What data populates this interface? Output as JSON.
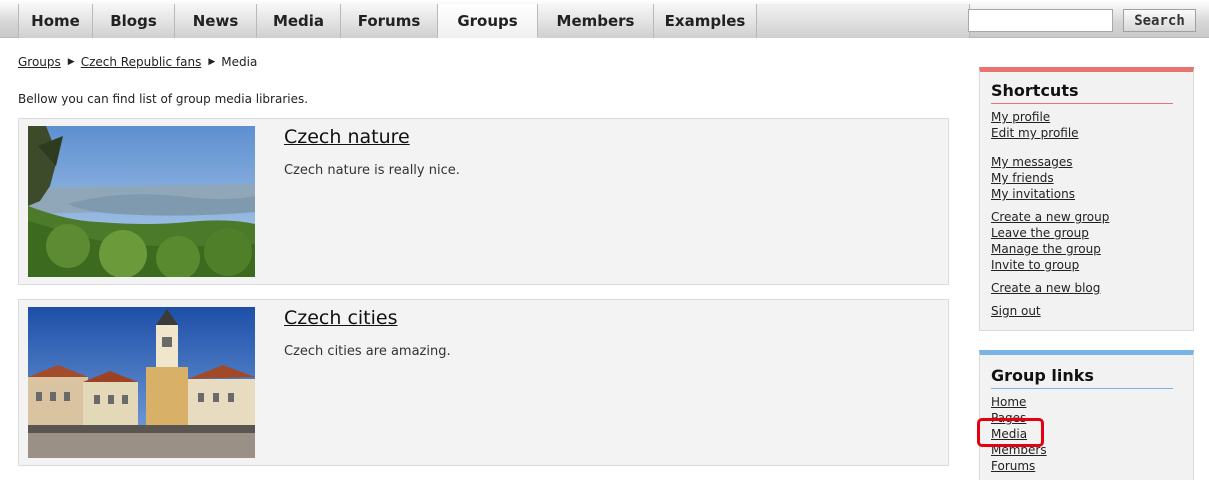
{
  "nav": {
    "items": [
      {
        "label": "Home"
      },
      {
        "label": "Blogs"
      },
      {
        "label": "News"
      },
      {
        "label": "Media"
      },
      {
        "label": "Forums"
      },
      {
        "label": "Groups",
        "active": true
      },
      {
        "label": "Members"
      },
      {
        "label": "Examples"
      }
    ],
    "search_placeholder": "",
    "search_label": "Search"
  },
  "breadcrumb": {
    "items": [
      "Groups",
      "Czech Republic fans"
    ],
    "current": "Media"
  },
  "intro": "Bellow you can find list of group media libraries.",
  "libraries": [
    {
      "title": "Czech nature",
      "description": "Czech nature is really nice."
    },
    {
      "title": "Czech cities",
      "description": "Czech cities are amazing."
    }
  ],
  "shortcuts": {
    "title": "Shortcuts",
    "accent": "#e8746f",
    "links": [
      "My profile",
      "Edit my profile",
      "My messages",
      "My friends",
      "My invitations",
      "Create a new group",
      "Leave the group",
      "Manage the group",
      "Invite to group",
      "Create a new blog",
      "Sign out"
    ]
  },
  "group_links": {
    "title": "Group links",
    "accent": "#78b4e6",
    "links": [
      "Home",
      "Pages",
      "Media",
      "Members",
      "Forums"
    ],
    "highlighted": "Media"
  },
  "colors": {
    "highlight": "#e3000f"
  }
}
